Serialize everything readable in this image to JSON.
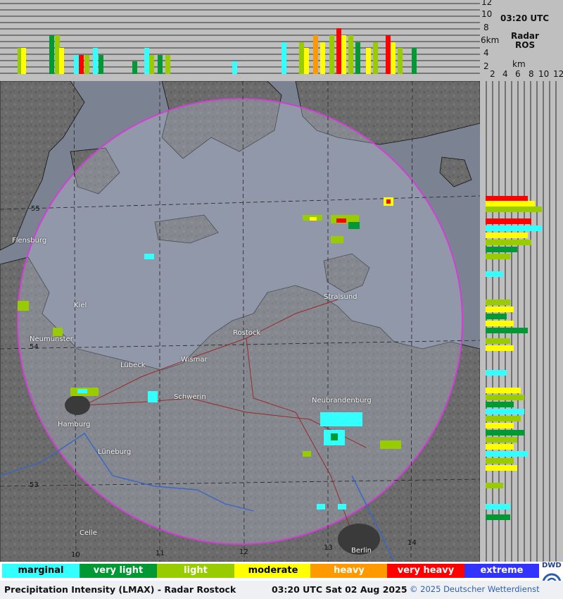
{
  "header": {
    "time": "03:20 UTC",
    "radar_label": "Radar",
    "station": "ROS",
    "height_unit_v": "6km",
    "height_ticks": [
      "12",
      "10",
      "8",
      "4",
      "2"
    ],
    "km_label": "km",
    "x_ticks": [
      "2",
      "4",
      "6",
      "8",
      "10",
      "12"
    ]
  },
  "legend": [
    {
      "label": "marginal",
      "color": "#33ffff",
      "text_color": "#000000"
    },
    {
      "label": "very light",
      "color": "#009933",
      "text_color": "#ffffff"
    },
    {
      "label": "light",
      "color": "#99cc00",
      "text_color": "#ffffff"
    },
    {
      "label": "moderate",
      "color": "#ffff00",
      "text_color": "#000000"
    },
    {
      "label": "heavy",
      "color": "#ff9900",
      "text_color": "#ffffff"
    },
    {
      "label": "very heavy",
      "color": "#ff0000",
      "text_color": "#ffffff"
    },
    {
      "label": "extreme",
      "color": "#3333ff",
      "text_color": "#ffffff"
    }
  ],
  "footer": {
    "title": "Precipitation Intensity (LMAX) - Radar Rostock",
    "timestamp": "03:20 UTC Sat 02 Aug 2025",
    "copyright": "© 2025 Deutscher Wetterdienst",
    "logo_text": "DWD"
  },
  "map": {
    "cities": [
      "Flensburg",
      "Kiel",
      "Neumünster",
      "Lübeck",
      "Wismar",
      "Rostock",
      "Stralsund",
      "Schwerin",
      "Neubrandenburg",
      "Hamburg",
      "Lüneburg",
      "Celle",
      "Berlin"
    ],
    "lat_labels": [
      "55",
      "54",
      "53"
    ],
    "lon_labels": [
      "10",
      "11",
      "12",
      "13",
      "14"
    ]
  }
}
